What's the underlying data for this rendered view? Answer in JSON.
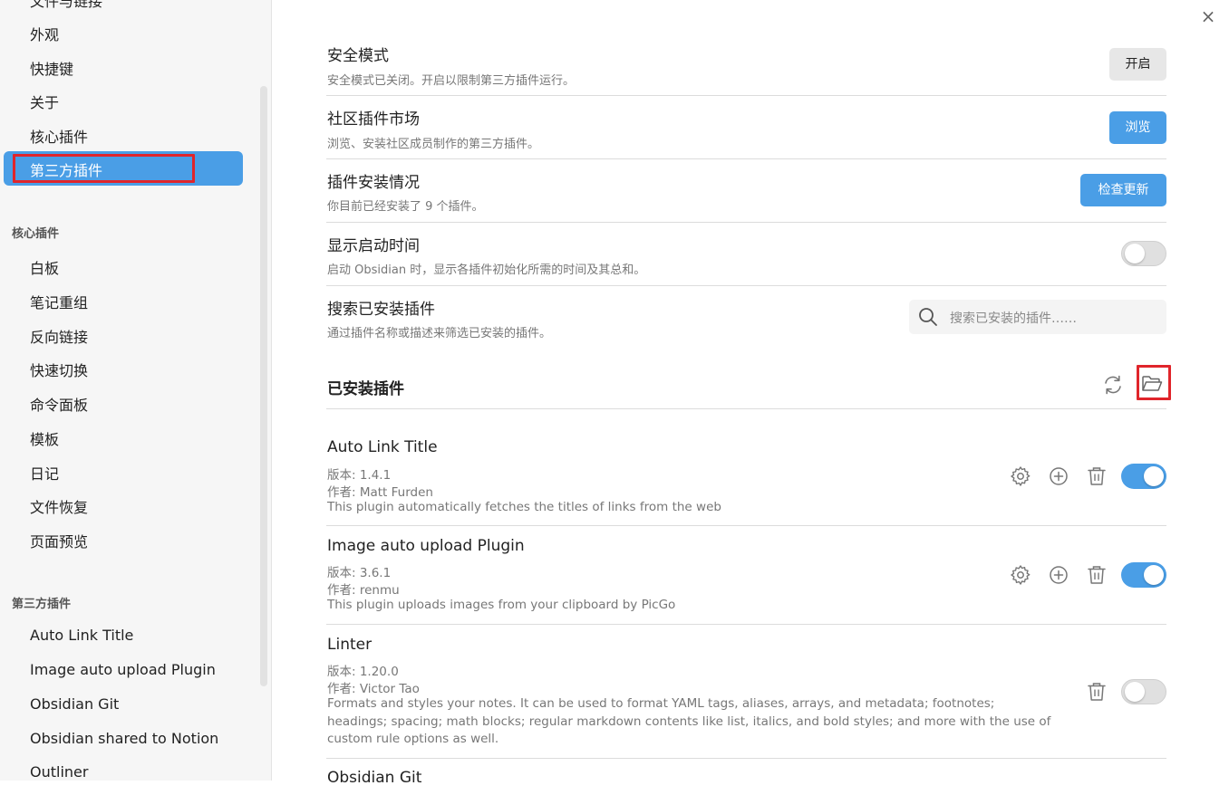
{
  "sidebar": {
    "top_items": [
      "文件与链接",
      "外观",
      "快捷键",
      "关于",
      "核心插件"
    ],
    "active_item": "第三方插件",
    "core_heading": "核心插件",
    "core_items": [
      "白板",
      "笔记重组",
      "反向链接",
      "快速切换",
      "命令面板",
      "模板",
      "日记",
      "文件恢复",
      "页面预览"
    ],
    "community_heading": "第三方插件",
    "community_items": [
      "Auto Link Title",
      "Image auto upload Plugin",
      "Obsidian Git",
      "Obsidian shared to Notion",
      "Outliner"
    ]
  },
  "main": {
    "close_icon": "×",
    "settings": [
      {
        "title": "安全模式",
        "desc": "安全模式已关闭。开启以限制第三方插件运行。",
        "button": "开启"
      },
      {
        "title": "社区插件市场",
        "desc": "浏览、安装社区成员制作的第三方插件。",
        "button": "浏览"
      },
      {
        "title": "插件安装情况",
        "desc": "你目前已经安装了 9 个插件。",
        "button": "检查更新"
      },
      {
        "title": "显示启动时间",
        "desc": "启动 Obsidian 时，显示各插件初始化所需的时间及其总和。",
        "toggle": "off"
      },
      {
        "title": "搜索已安装插件",
        "desc": "通过插件名称或描述来筛选已安装的插件。"
      }
    ],
    "search_placeholder": "搜索已安装的插件……",
    "installed_title": "已安装插件",
    "plugins": [
      {
        "name": "Auto Link Title",
        "version": "版本: 1.4.1",
        "author": "作者: Matt Furden",
        "desc": "This plugin automatically fetches the titles of links from the web",
        "enabled": true
      },
      {
        "name": "Image auto upload Plugin",
        "version": "版本: 3.6.1",
        "author": "作者: renmu",
        "desc": "This plugin uploads images from your clipboard by PicGo",
        "enabled": true
      },
      {
        "name": "Linter",
        "version": "版本: 1.20.0",
        "author": "作者: Victor Tao",
        "desc": "Formats and styles your notes. It can be used to format YAML tags, aliases, arrays, and metadata; footnotes; headings; spacing; math blocks; regular markdown contents like list, italics, and bold styles; and more with the use of custom rule options as well.",
        "enabled": false
      },
      {
        "name": "Obsidian Git"
      }
    ]
  },
  "colors": {
    "accent": "#4a9ee6",
    "highlight_box": "#e0252b"
  }
}
